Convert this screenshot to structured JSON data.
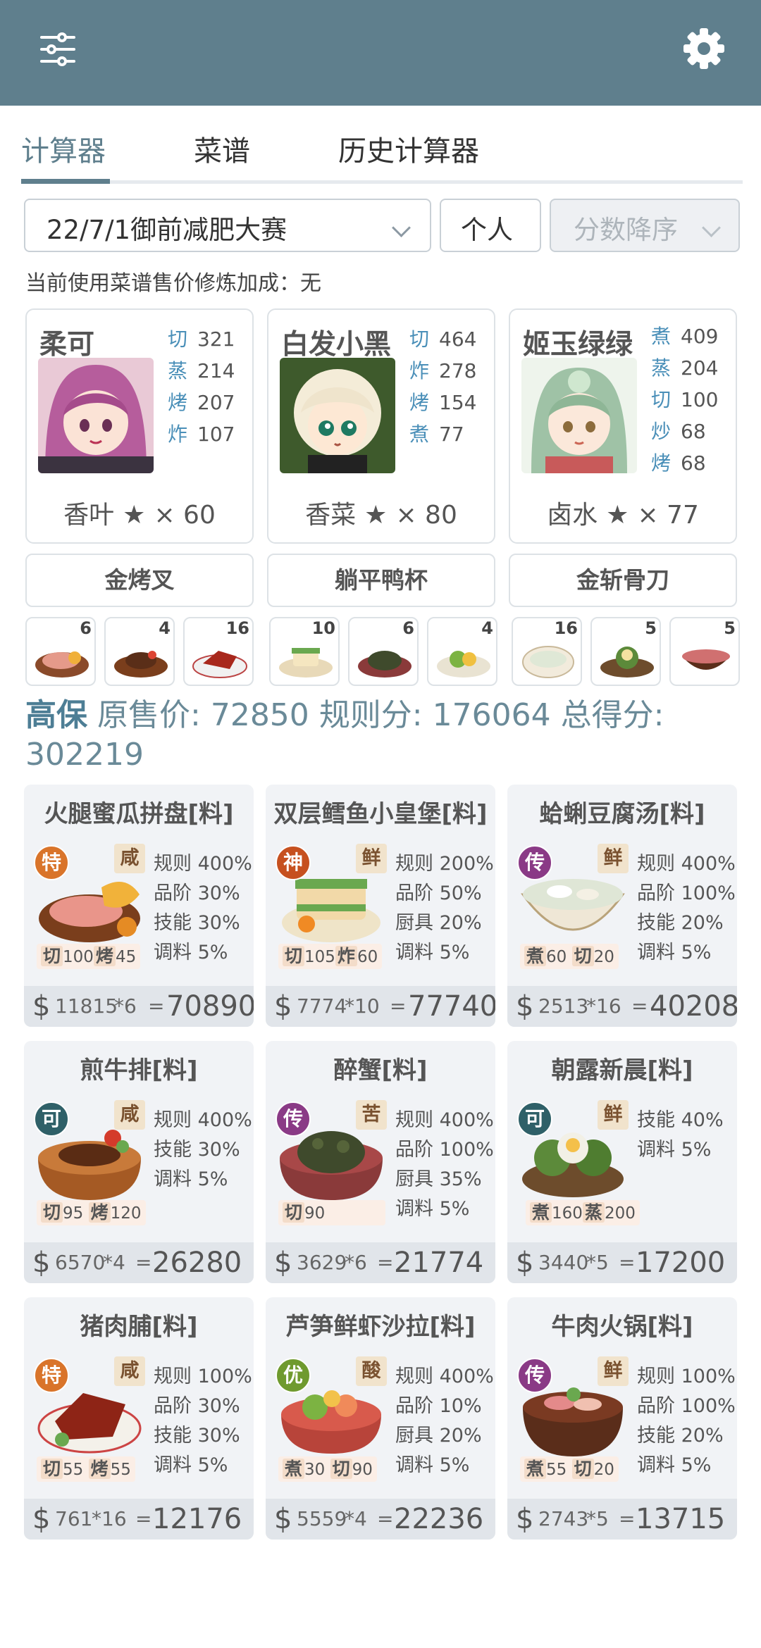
{
  "toolbar": {
    "menu_icon": "sliders-icon",
    "settings_icon": "gear-icon"
  },
  "tabs": [
    {
      "label": "计算器",
      "active": true
    },
    {
      "label": "菜谱"
    },
    {
      "label": "历史计算器"
    }
  ],
  "filters": {
    "contest": "22/7/1御前减肥大赛",
    "mode": "个人",
    "sort": "分数降序"
  },
  "note": "当前使用菜谱售价修炼加成：无",
  "chefs": [
    {
      "name": "柔可",
      "skills": [
        {
          "k": "切",
          "v": "321"
        },
        {
          "k": "蒸",
          "v": "214"
        },
        {
          "k": "烤",
          "v": "207"
        },
        {
          "k": "炸",
          "v": "107"
        }
      ],
      "condiment": "香叶",
      "star": "★",
      "mult": "× 60"
    },
    {
      "name": "白发小黑",
      "skills": [
        {
          "k": "切",
          "v": "464"
        },
        {
          "k": "炸",
          "v": "278"
        },
        {
          "k": "烤",
          "v": "154"
        },
        {
          "k": "煮",
          "v": "77"
        }
      ],
      "condiment": "香菜",
      "star": "★",
      "mult": "× 80"
    },
    {
      "name": "姬玉绿绿",
      "skills": [
        {
          "k": "煮",
          "v": "409"
        },
        {
          "k": "蒸",
          "v": "204"
        },
        {
          "k": "切",
          "v": "100"
        },
        {
          "k": "炒",
          "v": "68"
        },
        {
          "k": "烤",
          "v": "68"
        }
      ],
      "condiment": "卤水",
      "star": "★",
      "mult": "× 77"
    }
  ],
  "tools": [
    "金烤叉",
    "躺平鸭杯",
    "金斩骨刀"
  ],
  "dish_counts": [
    "6",
    "4",
    "16",
    "10",
    "6",
    "4",
    "16",
    "5",
    "5"
  ],
  "score": {
    "chef": "高保",
    "orig_label": "原售价:",
    "orig": "72850",
    "rule_label": "规则分:",
    "rule": "176064",
    "total_label": "总得分:",
    "total": "302219"
  },
  "recipes": [
    {
      "name": "火腿蜜瓜拼盘[料]",
      "rarity": "特",
      "rarity_color": "#d9742a",
      "flavor": "咸",
      "bonuses": [
        "规则 400%",
        "品阶 30%",
        "技能 30%",
        "调料 5%"
      ],
      "skills": [
        {
          "k": "切",
          "v": "100"
        },
        {
          "k": "烤",
          "v": "45"
        }
      ],
      "price": "11815",
      "count": "*6",
      "total": "70890"
    },
    {
      "name": "双层鳕鱼小皇堡[料]",
      "rarity": "神",
      "rarity_color": "#c6501f",
      "flavor": "鲜",
      "bonuses": [
        "规则 200%",
        "品阶 50%",
        "厨具 20%",
        "调料 5%"
      ],
      "skills": [
        {
          "k": "切",
          "v": "105"
        },
        {
          "k": "炸",
          "v": "60"
        }
      ],
      "price": "7774",
      "count": "*10",
      "total": "77740"
    },
    {
      "name": "蛤蜊豆腐汤[料]",
      "rarity": "传",
      "rarity_color": "#8a3a86",
      "flavor": "鲜",
      "bonuses": [
        "规则 400%",
        "品阶 100%",
        "技能 20%",
        "调料 5%"
      ],
      "skills": [
        {
          "k": "煮",
          "v": "60"
        },
        {
          "k": "切",
          "v": "20"
        }
      ],
      "price": "2513",
      "count": "*16",
      "total": "40208"
    },
    {
      "name": "煎牛排[料]",
      "rarity": "可",
      "rarity_color": "#2f6068",
      "flavor": "咸",
      "bonuses": [
        "规则 400%",
        "技能 30%",
        "调料 5%"
      ],
      "skills": [
        {
          "k": "切",
          "v": "95"
        },
        {
          "k": "烤",
          "v": "120"
        }
      ],
      "price": "6570",
      "count": "*4",
      "total": "26280"
    },
    {
      "name": "醉蟹[料]",
      "rarity": "传",
      "rarity_color": "#8a3a86",
      "flavor": "苦",
      "bonuses": [
        "规则 400%",
        "品阶 100%",
        "厨具 35%",
        "调料 5%"
      ],
      "skills": [
        {
          "k": "切",
          "v": "90"
        }
      ],
      "price": "3629",
      "count": "*6",
      "total": "21774"
    },
    {
      "name": "朝露新晨[料]",
      "rarity": "可",
      "rarity_color": "#2f6068",
      "flavor": "鲜",
      "bonuses": [
        "技能 40%",
        "调料 5%"
      ],
      "skills": [
        {
          "k": "煮",
          "v": "160"
        },
        {
          "k": "蒸",
          "v": "200"
        }
      ],
      "price": "3440",
      "count": "*5",
      "total": "17200"
    },
    {
      "name": "猪肉脯[料]",
      "rarity": "特",
      "rarity_color": "#d9742a",
      "flavor": "咸",
      "bonuses": [
        "规则 100%",
        "品阶 30%",
        "技能 30%",
        "调料 5%"
      ],
      "skills": [
        {
          "k": "切",
          "v": "55"
        },
        {
          "k": "烤",
          "v": "55"
        }
      ],
      "price": "761",
      "count": "*16",
      "total": "12176"
    },
    {
      "name": "芦笋鲜虾沙拉[料]",
      "rarity": "优",
      "rarity_color": "#6f9a2e",
      "flavor": "酸",
      "bonuses": [
        "规则 400%",
        "品阶 10%",
        "厨具 20%",
        "调料 5%"
      ],
      "skills": [
        {
          "k": "煮",
          "v": "30"
        },
        {
          "k": "切",
          "v": "90"
        }
      ],
      "price": "5559",
      "count": "*4",
      "total": "22236"
    },
    {
      "name": "牛肉火锅[料]",
      "rarity": "传",
      "rarity_color": "#8a3a86",
      "flavor": "鲜",
      "bonuses": [
        "规则 100%",
        "品阶 100%",
        "技能 20%",
        "调料 5%"
      ],
      "skills": [
        {
          "k": "煮",
          "v": "55"
        },
        {
          "k": "切",
          "v": "20"
        }
      ],
      "price": "2743",
      "count": "*5",
      "total": "13715"
    }
  ],
  "colors": {
    "primary": "#5f7f8d",
    "skill_key": "#4a8fb8",
    "card_bg": "#f1f3f6",
    "price_bar": "#e1e5ea"
  }
}
